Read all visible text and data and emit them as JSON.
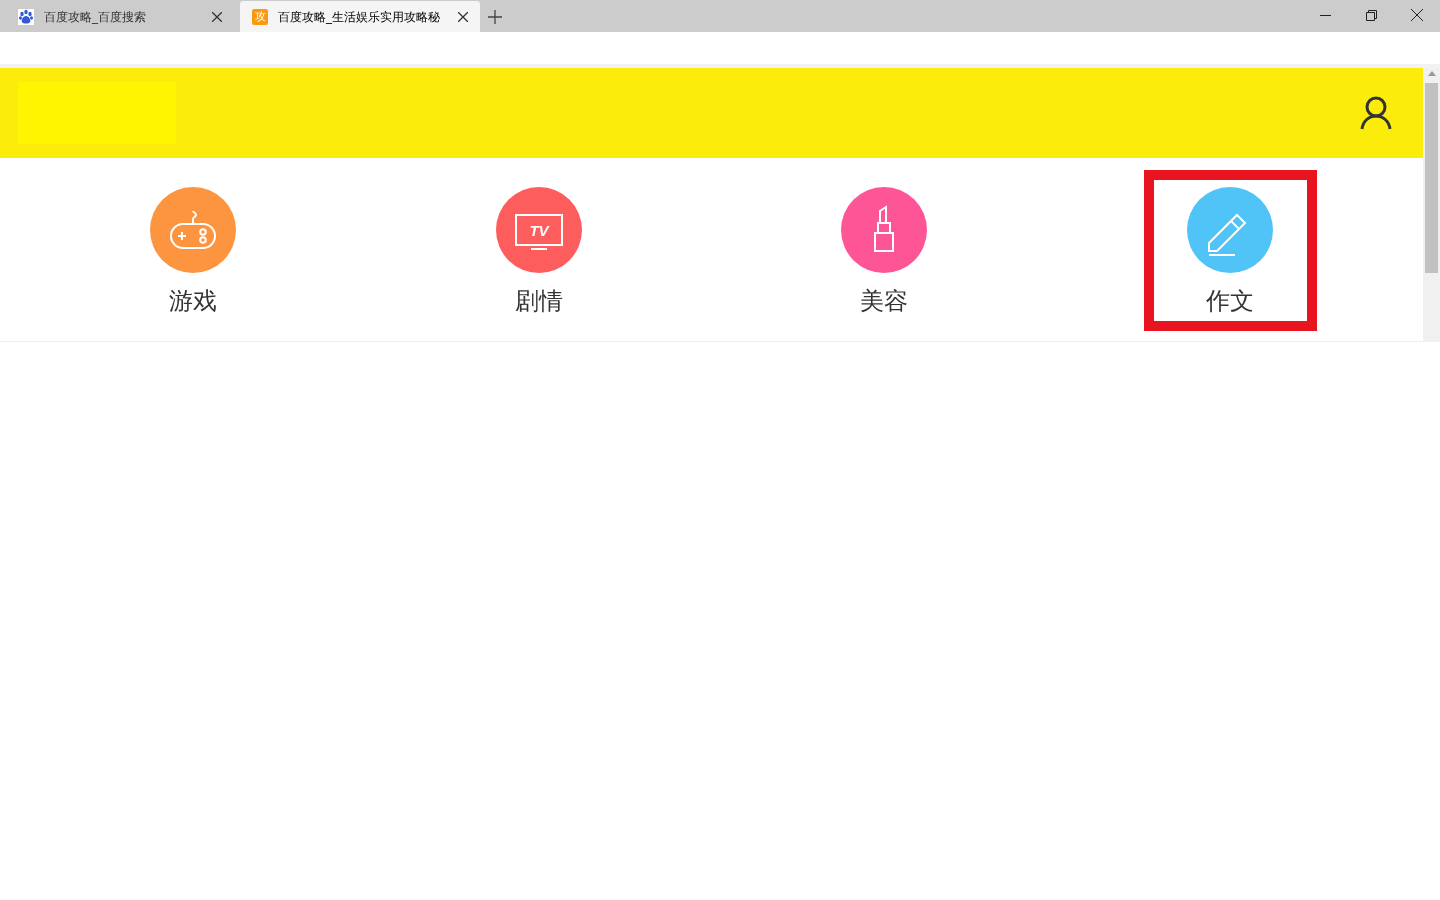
{
  "browser": {
    "tabs": [
      {
        "title": "百度攻略_百度搜索",
        "selected": false
      },
      {
        "title": "百度攻略_生活娱乐实用攻略秘",
        "favicon_text": "攻",
        "selected": true
      }
    ]
  },
  "categories": [
    {
      "label": "游戏",
      "color": "#fd943f",
      "highlighted": false
    },
    {
      "label": "剧情",
      "color": "#fe5d5d",
      "icon_text": "TV",
      "highlighted": false
    },
    {
      "label": "美容",
      "color": "#fd5596",
      "highlighted": false
    },
    {
      "label": "作文",
      "color": "#50c3f7",
      "highlighted": true
    }
  ]
}
